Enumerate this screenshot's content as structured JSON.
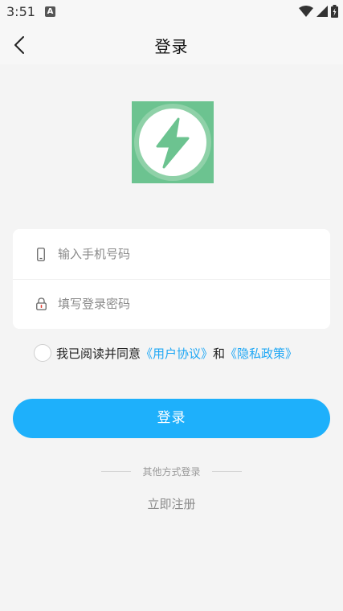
{
  "status": {
    "time": "3:51",
    "notification_letter": "A"
  },
  "header": {
    "title": "登录"
  },
  "form": {
    "phone_placeholder": "输入手机号码",
    "password_placeholder": "填写登录密码"
  },
  "agreement": {
    "prefix": "我已阅读并同意",
    "user_agreement": "《用户协议》",
    "and": "和",
    "privacy_policy": "《隐私政策》"
  },
  "login_button_label": "登录",
  "other_methods_label": "其他方式登录",
  "register_label": "立即注册",
  "colors": {
    "accent": "#1eb0fb",
    "link": "#1ea7f5",
    "logo_bg": "#6cc390"
  },
  "icons": {
    "back": "back-arrow-icon",
    "phone": "phone-icon",
    "lock": "lock-icon",
    "logo": "lightning-icon"
  }
}
